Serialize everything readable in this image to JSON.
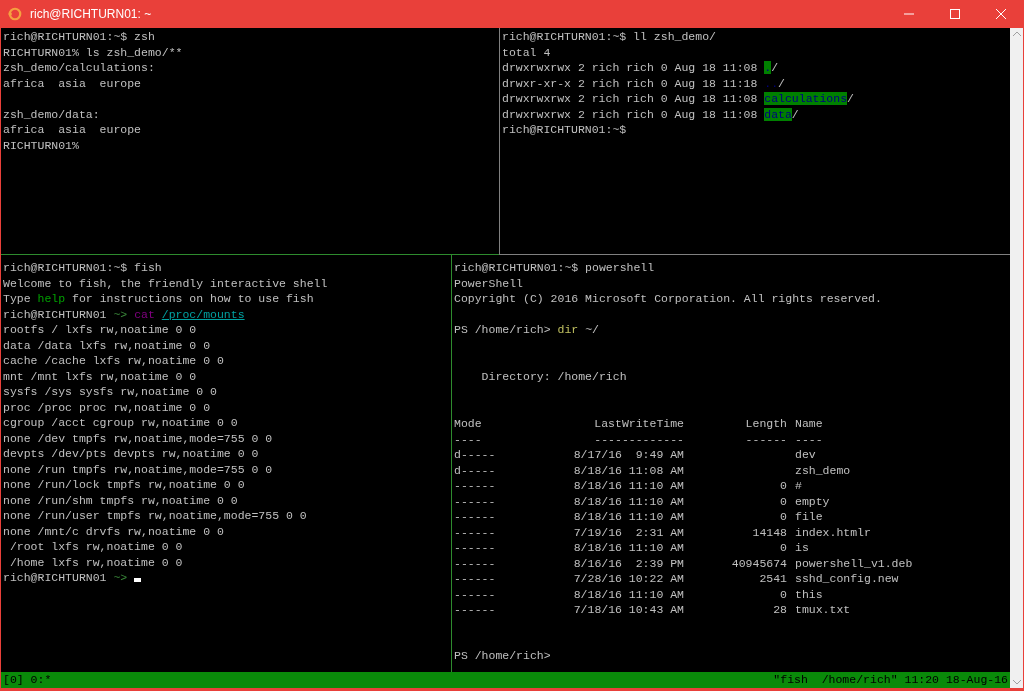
{
  "window": {
    "title": "rich@RICHTURN01: ~"
  },
  "panes": [
    {
      "kind": "lines",
      "lines": [
        {
          "kind": "text",
          "segments": [
            {
              "text": "rich@RICHTURN01:~$ zsh",
              "kind": "plain"
            }
          ]
        },
        {
          "kind": "text",
          "segments": [
            {
              "text": "RICHTURN01% ls zsh_demo/**",
              "kind": "plain"
            }
          ]
        },
        {
          "kind": "text",
          "segments": [
            {
              "text": "zsh_demo/calculations:",
              "kind": "plain"
            }
          ]
        },
        {
          "kind": "text",
          "segments": [
            {
              "text": "africa  asia  europe",
              "kind": "plain"
            }
          ]
        },
        {
          "kind": "blank"
        },
        {
          "kind": "text",
          "segments": [
            {
              "text": "zsh_demo/data:",
              "kind": "plain"
            }
          ]
        },
        {
          "kind": "text",
          "segments": [
            {
              "text": "africa  asia  europe",
              "kind": "plain"
            }
          ]
        },
        {
          "kind": "text",
          "segments": [
            {
              "text": "RICHTURN01%",
              "kind": "plain"
            }
          ]
        }
      ]
    },
    {
      "kind": "lines",
      "lines": [
        {
          "kind": "text",
          "segments": [
            {
              "text": "rich@RICHTURN01:~$ ll zsh_demo/",
              "kind": "plain"
            }
          ]
        },
        {
          "kind": "text",
          "segments": [
            {
              "text": "total 4",
              "kind": "plain"
            }
          ]
        },
        {
          "kind": "text",
          "segments": [
            {
              "text": "drwxrwxrwx 2 rich rich 0 Aug 18 11:08 ",
              "kind": "plain"
            },
            {
              "text": ".",
              "kind": "highlight"
            },
            {
              "text": "/",
              "kind": "plain"
            }
          ]
        },
        {
          "kind": "text",
          "segments": [
            {
              "text": "drwxr-xr-x 2 rich rich 0 Aug 18 11:18 ",
              "kind": "plain"
            },
            {
              "text": "..",
              "kind": "dir"
            },
            {
              "text": "/",
              "kind": "plain"
            }
          ]
        },
        {
          "kind": "text",
          "segments": [
            {
              "text": "drwxrwxrwx 2 rich rich 0 Aug 18 11:08 ",
              "kind": "plain"
            },
            {
              "text": "calculations",
              "kind": "highlight"
            },
            {
              "text": "/",
              "kind": "plain"
            }
          ]
        },
        {
          "kind": "text",
          "segments": [
            {
              "text": "drwxrwxrwx 2 rich rich 0 Aug 18 11:08 ",
              "kind": "plain"
            },
            {
              "text": "data",
              "kind": "highlight"
            },
            {
              "text": "/",
              "kind": "plain"
            }
          ]
        },
        {
          "kind": "text",
          "segments": [
            {
              "text": "rich@RICHTURN01:~$",
              "kind": "plain"
            }
          ]
        }
      ]
    },
    {
      "kind": "lines",
      "lines": [
        {
          "kind": "text",
          "segments": [
            {
              "text": "rich@RICHTURN01:~$ fish",
              "kind": "plain"
            }
          ]
        },
        {
          "kind": "text",
          "segments": [
            {
              "text": "Welcome to fish, the friendly interactive shell",
              "kind": "plain"
            }
          ]
        },
        {
          "kind": "text",
          "segments": [
            {
              "text": "Type ",
              "kind": "plain"
            },
            {
              "text": "help",
              "kind": "keyword"
            },
            {
              "text": " for instructions on how to use fish",
              "kind": "plain"
            }
          ]
        },
        {
          "kind": "text",
          "segments": [
            {
              "text": "rich@RICHTURN01 ",
              "kind": "plain"
            },
            {
              "text": "~> ",
              "kind": "prompt"
            },
            {
              "text": "cat ",
              "kind": "command"
            },
            {
              "text": "/proc/mounts",
              "kind": "path"
            }
          ]
        },
        {
          "kind": "text",
          "segments": [
            {
              "text": "rootfs / lxfs rw,noatime 0 0",
              "kind": "plain"
            }
          ]
        },
        {
          "kind": "text",
          "segments": [
            {
              "text": "data /data lxfs rw,noatime 0 0",
              "kind": "plain"
            }
          ]
        },
        {
          "kind": "text",
          "segments": [
            {
              "text": "cache /cache lxfs rw,noatime 0 0",
              "kind": "plain"
            }
          ]
        },
        {
          "kind": "text",
          "segments": [
            {
              "text": "mnt /mnt lxfs rw,noatime 0 0",
              "kind": "plain"
            }
          ]
        },
        {
          "kind": "text",
          "segments": [
            {
              "text": "sysfs /sys sysfs rw,noatime 0 0",
              "kind": "plain"
            }
          ]
        },
        {
          "kind": "text",
          "segments": [
            {
              "text": "proc /proc proc rw,noatime 0 0",
              "kind": "plain"
            }
          ]
        },
        {
          "kind": "text",
          "segments": [
            {
              "text": "cgroup /acct cgroup rw,noatime 0 0",
              "kind": "plain"
            }
          ]
        },
        {
          "kind": "text",
          "segments": [
            {
              "text": "none /dev tmpfs rw,noatime,mode=755 0 0",
              "kind": "plain"
            }
          ]
        },
        {
          "kind": "text",
          "segments": [
            {
              "text": "devpts /dev/pts devpts rw,noatime 0 0",
              "kind": "plain"
            }
          ]
        },
        {
          "kind": "text",
          "segments": [
            {
              "text": "none /run tmpfs rw,noatime,mode=755 0 0",
              "kind": "plain"
            }
          ]
        },
        {
          "kind": "text",
          "segments": [
            {
              "text": "none /run/lock tmpfs rw,noatime 0 0",
              "kind": "plain"
            }
          ]
        },
        {
          "kind": "text",
          "segments": [
            {
              "text": "none /run/shm tmpfs rw,noatime 0 0",
              "kind": "plain"
            }
          ]
        },
        {
          "kind": "text",
          "segments": [
            {
              "text": "none /run/user tmpfs rw,noatime,mode=755 0 0",
              "kind": "plain"
            }
          ]
        },
        {
          "kind": "text",
          "segments": [
            {
              "text": "none /mnt/c drvfs rw,noatime 0 0",
              "kind": "plain"
            }
          ]
        },
        {
          "kind": "text",
          "segments": [
            {
              "text": " /root lxfs rw,noatime 0 0",
              "kind": "plain"
            }
          ]
        },
        {
          "kind": "text",
          "segments": [
            {
              "text": " /home lxfs rw,noatime 0 0",
              "kind": "plain"
            }
          ]
        },
        {
          "kind": "prompt",
          "segments": [
            {
              "text": "rich@RICHTURN01 ",
              "kind": "plain"
            },
            {
              "text": "~>",
              "kind": "prompt"
            }
          ]
        }
      ]
    },
    {
      "kind": "powershell",
      "before": [
        {
          "kind": "text",
          "segments": [
            {
              "text": "rich@RICHTURN01:~$ powershell",
              "kind": "plain"
            }
          ]
        },
        {
          "kind": "text",
          "segments": [
            {
              "text": "PowerShell",
              "kind": "plain"
            }
          ]
        },
        {
          "kind": "text",
          "segments": [
            {
              "text": "Copyright (C) 2016 Microsoft Corporation. All rights reserved.",
              "kind": "plain"
            }
          ]
        },
        {
          "kind": "blank"
        },
        {
          "kind": "text",
          "segments": [
            {
              "text": "PS /home/rich> ",
              "kind": "plain"
            },
            {
              "text": "dir",
              "kind": "cmdlet"
            },
            {
              "text": " ~/",
              "kind": "plain"
            }
          ]
        },
        {
          "kind": "blank"
        },
        {
          "kind": "blank"
        },
        {
          "kind": "text",
          "segments": [
            {
              "text": "    Directory: /home/rich",
              "kind": "plain"
            }
          ]
        },
        {
          "kind": "blank"
        },
        {
          "kind": "blank"
        }
      ],
      "table": {
        "columns": [
          "Mode",
          "LastWriteTime",
          "Length",
          "Name"
        ],
        "rules": [
          "----",
          "-------------",
          "------",
          "----"
        ],
        "rows": [
          {
            "mode": "d-----",
            "date": "8/17/16",
            "time": "9:49 AM",
            "name": "dev"
          },
          {
            "mode": "d-----",
            "date": "8/18/16",
            "time": "11:08 AM",
            "name": "zsh_demo"
          },
          {
            "mode": "------",
            "date": "8/18/16",
            "time": "11:10 AM",
            "length": "0",
            "name": "#"
          },
          {
            "mode": "------",
            "date": "8/18/16",
            "time": "11:10 AM",
            "length": "0",
            "name": "empty"
          },
          {
            "mode": "------",
            "date": "8/18/16",
            "time": "11:10 AM",
            "length": "0",
            "name": "file"
          },
          {
            "mode": "------",
            "date": "7/19/16",
            "time": "2:31 AM",
            "length": "14148",
            "name": "index.htmlr"
          },
          {
            "mode": "------",
            "date": "8/18/16",
            "time": "11:10 AM",
            "length": "0",
            "name": "is"
          },
          {
            "mode": "------",
            "date": "8/16/16",
            "time": "2:39 PM",
            "length": "40945674",
            "name": "powershell_v1.deb"
          },
          {
            "mode": "------",
            "date": "7/28/16",
            "time": "10:22 AM",
            "length": "2541",
            "name": "sshd_config.new"
          },
          {
            "mode": "------",
            "date": "8/18/16",
            "time": "11:10 AM",
            "length": "0",
            "name": "this"
          },
          {
            "mode": "------",
            "date": "7/18/16",
            "time": "10:43 AM",
            "length": "28",
            "name": "tmux.txt"
          }
        ]
      },
      "after": [
        {
          "kind": "blank"
        },
        {
          "kind": "blank"
        },
        {
          "kind": "text",
          "segments": [
            {
              "text": "PS /home/rich>",
              "kind": "plain"
            }
          ]
        }
      ]
    }
  ],
  "status_bar": {
    "left": "[0] 0:*",
    "right": "\"fish  /home/rich\" 11:20 18-Aug-16"
  }
}
